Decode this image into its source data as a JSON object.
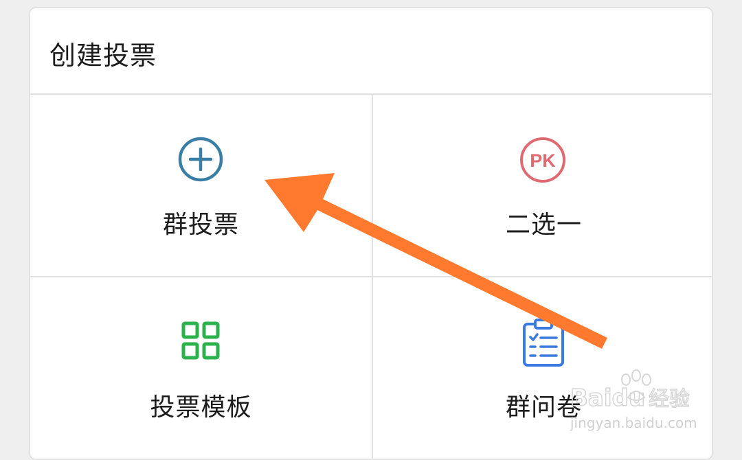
{
  "header": {
    "title": "创建投票"
  },
  "options": [
    {
      "label": "群投票",
      "icon": "plus-circle-icon",
      "color": "#3a7ea6"
    },
    {
      "label": "二选一",
      "icon": "pk-icon",
      "icon_text": "PK",
      "color": "#e06a72"
    },
    {
      "label": "投票模板",
      "icon": "grid-template-icon",
      "color": "#2bb24c"
    },
    {
      "label": "群问卷",
      "icon": "questionnaire-icon",
      "color": "#3b7ae0"
    }
  ],
  "annotation": {
    "arrow_color": "#ff7a2e"
  },
  "watermark": {
    "brand": "Baidu",
    "brand_cn": "经验",
    "url": "jingyan.baidu.com"
  }
}
